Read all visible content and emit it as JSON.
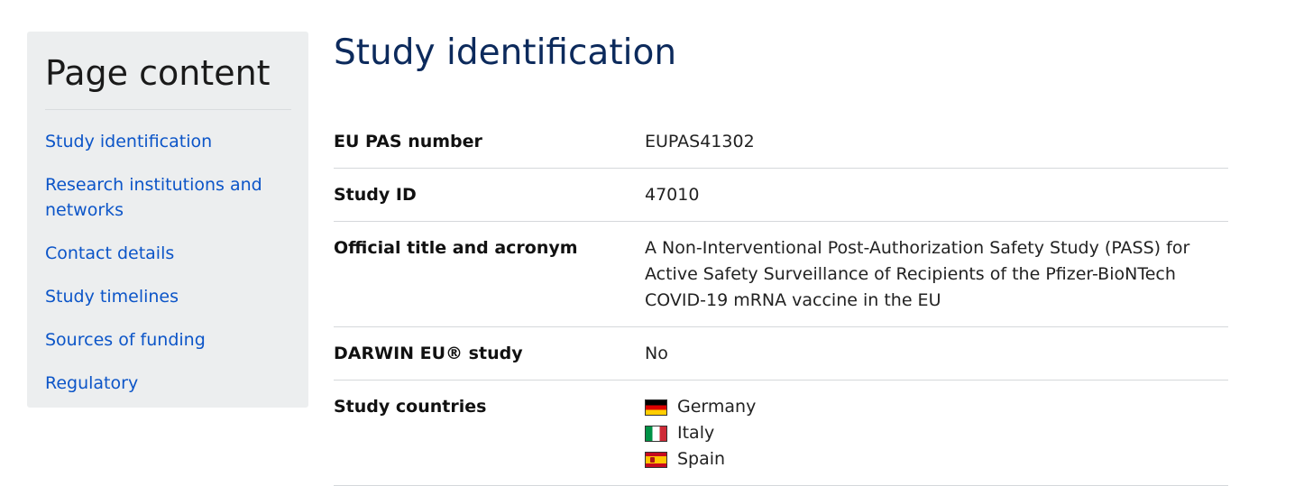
{
  "sidebar": {
    "title": "Page content",
    "items": [
      {
        "label": "Study identification"
      },
      {
        "label": "Research institutions and networks"
      },
      {
        "label": "Contact details"
      },
      {
        "label": "Study timelines"
      },
      {
        "label": "Sources of funding"
      },
      {
        "label": "Regulatory"
      }
    ]
  },
  "main": {
    "title": "Study identification",
    "rows": {
      "eu_pas_number": {
        "label": "EU PAS number",
        "value": "EUPAS41302"
      },
      "study_id": {
        "label": "Study ID",
        "value": "47010"
      },
      "official_title": {
        "label": "Official title and acronym",
        "value": "A Non-Interventional Post-Authorization Safety Study (PASS) for Active Safety Surveillance of Recipients of the Pfizer-BioNTech COVID-19 mRNA vaccine in the EU"
      },
      "darwin": {
        "label": "DARWIN EU® study",
        "value": "No"
      },
      "countries": {
        "label": "Study countries",
        "items": [
          {
            "name": "Germany",
            "flag_icon": "germany-flag-icon"
          },
          {
            "name": "Italy",
            "flag_icon": "italy-flag-icon"
          },
          {
            "name": "Spain",
            "flag_icon": "spain-flag-icon"
          }
        ]
      }
    }
  }
}
